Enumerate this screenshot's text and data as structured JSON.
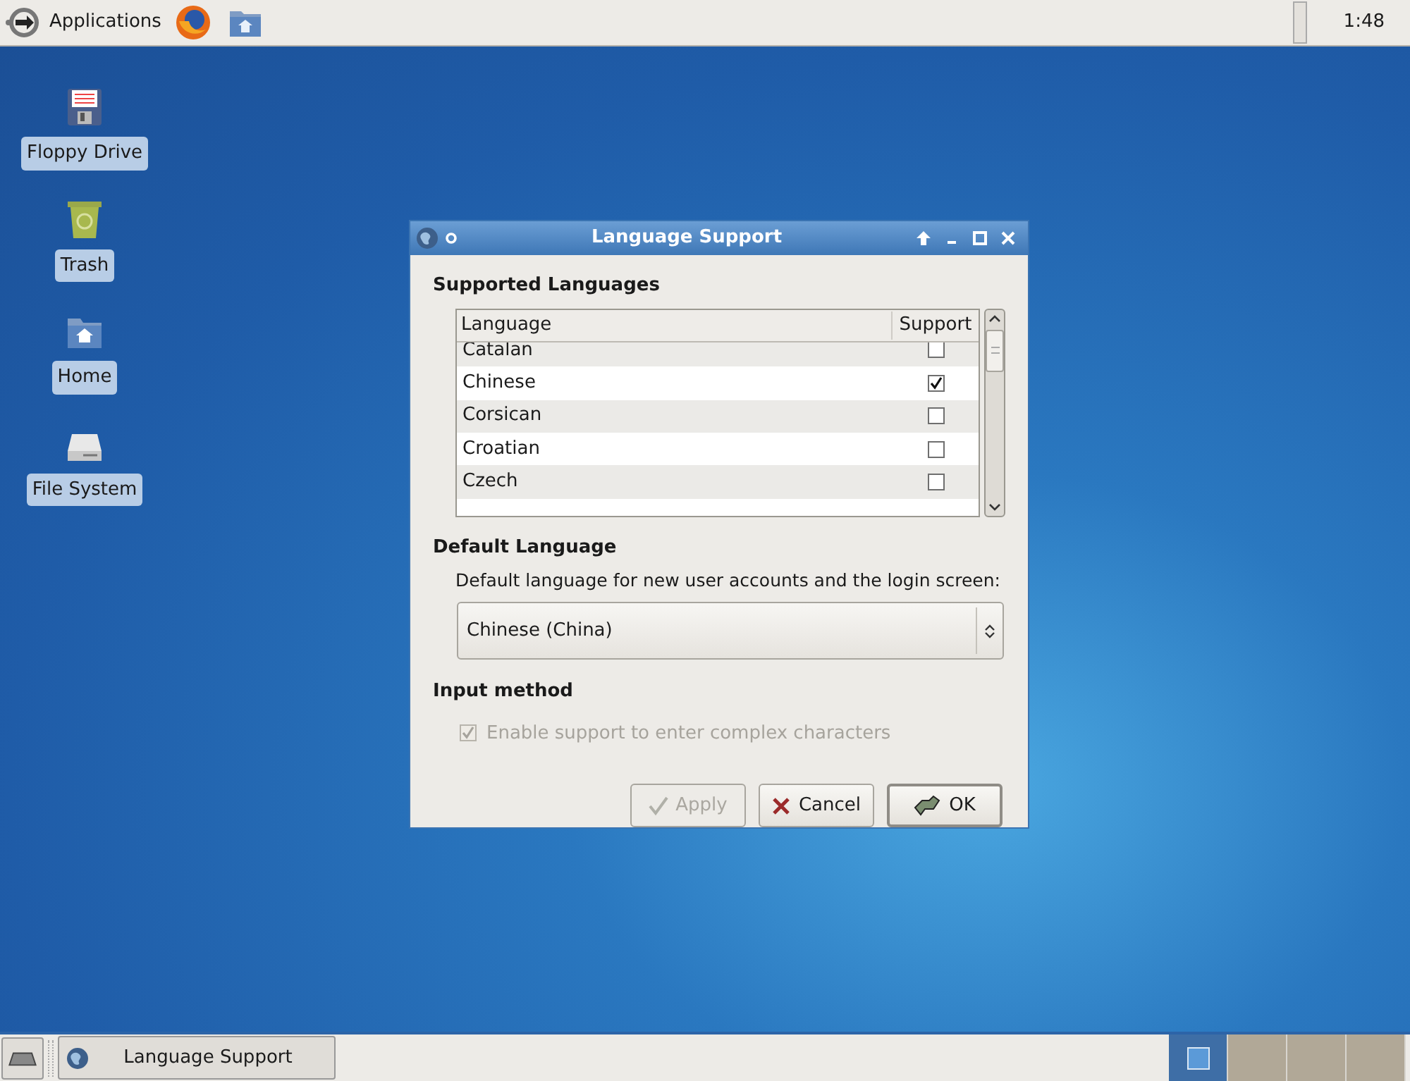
{
  "top_panel": {
    "menu": "Applications",
    "clock": "1:48"
  },
  "desktop_icons": [
    {
      "label": "Floppy Drive",
      "kind": "floppy"
    },
    {
      "label": "Trash",
      "kind": "trash"
    },
    {
      "label": "Home",
      "kind": "home"
    },
    {
      "label": "File System",
      "kind": "drive"
    }
  ],
  "dialog": {
    "title": "Language Support",
    "supported_heading": "Supported Languages",
    "columns": [
      "Language",
      "Support"
    ],
    "rows": [
      {
        "language": "Catalan",
        "checked": false
      },
      {
        "language": "Chinese",
        "checked": true
      },
      {
        "language": "Corsican",
        "checked": false
      },
      {
        "language": "Croatian",
        "checked": false
      },
      {
        "language": "Czech",
        "checked": false
      }
    ],
    "default_heading": "Default Language",
    "default_description": "Default language for new user accounts and the login screen:",
    "default_select": "Chinese (China)",
    "input_heading": "Input method",
    "input_checkbox": {
      "label": "Enable support to enter complex characters",
      "checked": true,
      "disabled": true
    },
    "buttons": [
      {
        "label": "Apply",
        "kind": "apply",
        "disabled": true
      },
      {
        "label": "Cancel",
        "kind": "cancel",
        "disabled": false
      },
      {
        "label": "OK",
        "kind": "ok",
        "disabled": false
      }
    ]
  },
  "taskbar": {
    "tasks": [
      {
        "label": "Language Support"
      }
    ],
    "workspaces": [
      {
        "selected": true
      },
      {
        "selected": false
      },
      {
        "selected": false
      },
      {
        "selected": false
      }
    ]
  }
}
